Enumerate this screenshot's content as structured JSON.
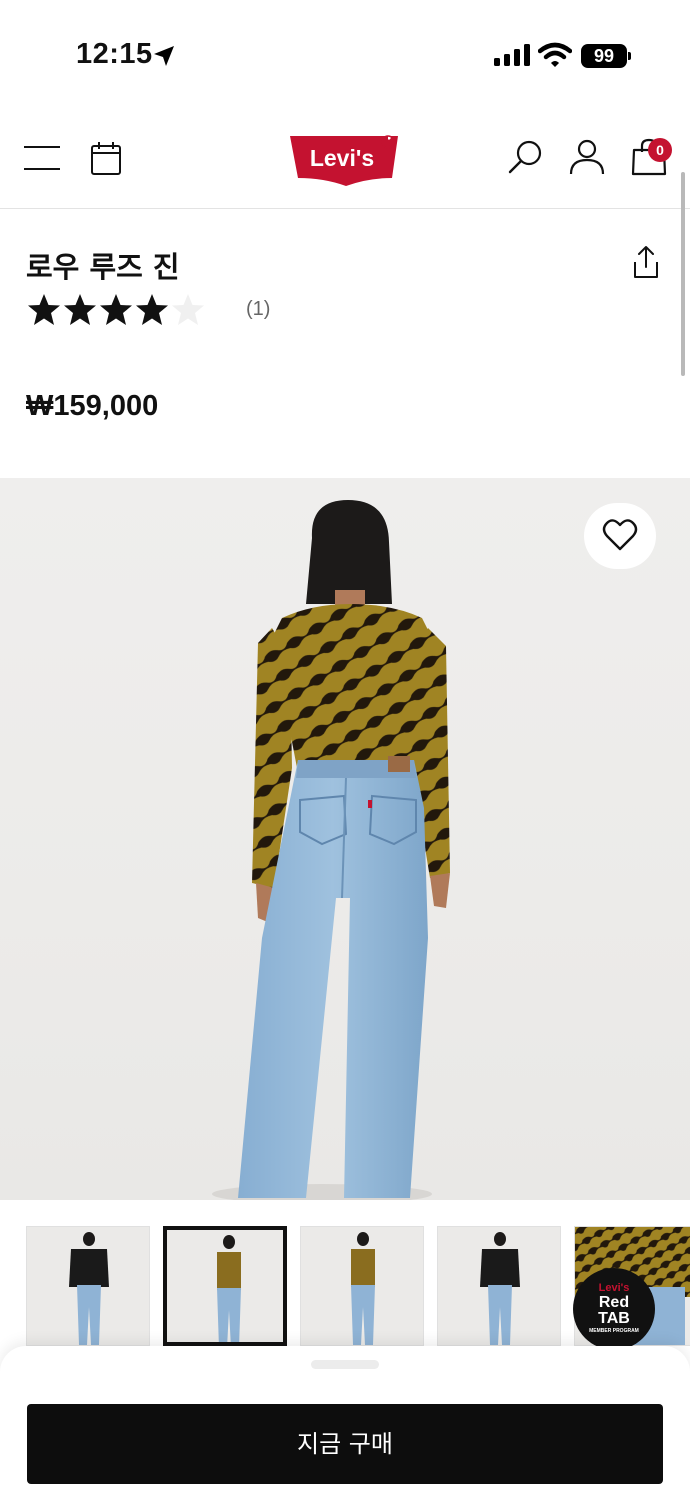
{
  "status_bar": {
    "time": "12:15",
    "battery": "99"
  },
  "header": {
    "logo_text": "Levi's",
    "cart_count": "0",
    "brand_color": "#c41230"
  },
  "product": {
    "title": "로우 루즈 진",
    "rating": 4,
    "rating_max": 5,
    "review_count": "(1)",
    "price": "₩159,000"
  },
  "gallery": {
    "thumbnail_count": 5,
    "selected_index": 1
  },
  "badge": {
    "line1": "Levi's",
    "line2": "Red",
    "line3": "TAB",
    "line4": "MEMBER PROGRAM"
  },
  "cta": {
    "buy_now_label": "지금 구매"
  }
}
